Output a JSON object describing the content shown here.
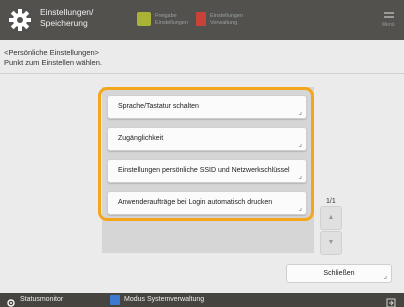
{
  "header": {
    "title_line1": "Einstellungen/",
    "title_line2": "Speicherung",
    "btn1_line1": "Freigabe",
    "btn1_line2": "Einstellungen",
    "btn2_line1": "Einstellungen",
    "btn2_line2": "Verwaltung",
    "menu_label": "Menü"
  },
  "instructions": {
    "line1": "<Persönliche Einstellungen>",
    "line2": "Punkt zum Einstellen wählen."
  },
  "list": {
    "items": [
      {
        "label": "Sprache/Tastatur schalten"
      },
      {
        "label": "Zugänglichkeit"
      },
      {
        "label": "Einstellungen persönliche SSID und Netzwerkschlüssel"
      },
      {
        "label": "Anwenderaufträge bei Login automatisch drucken"
      }
    ],
    "page_indicator": "1/1"
  },
  "close_label": "Schließen",
  "footer": {
    "status_monitor": "Statusmonitor",
    "mode": "Modus Systemverwaltung"
  },
  "colors": {
    "header_bg": "#52514e",
    "highlight": "#f3a61b",
    "footer_bg": "#45443f"
  }
}
